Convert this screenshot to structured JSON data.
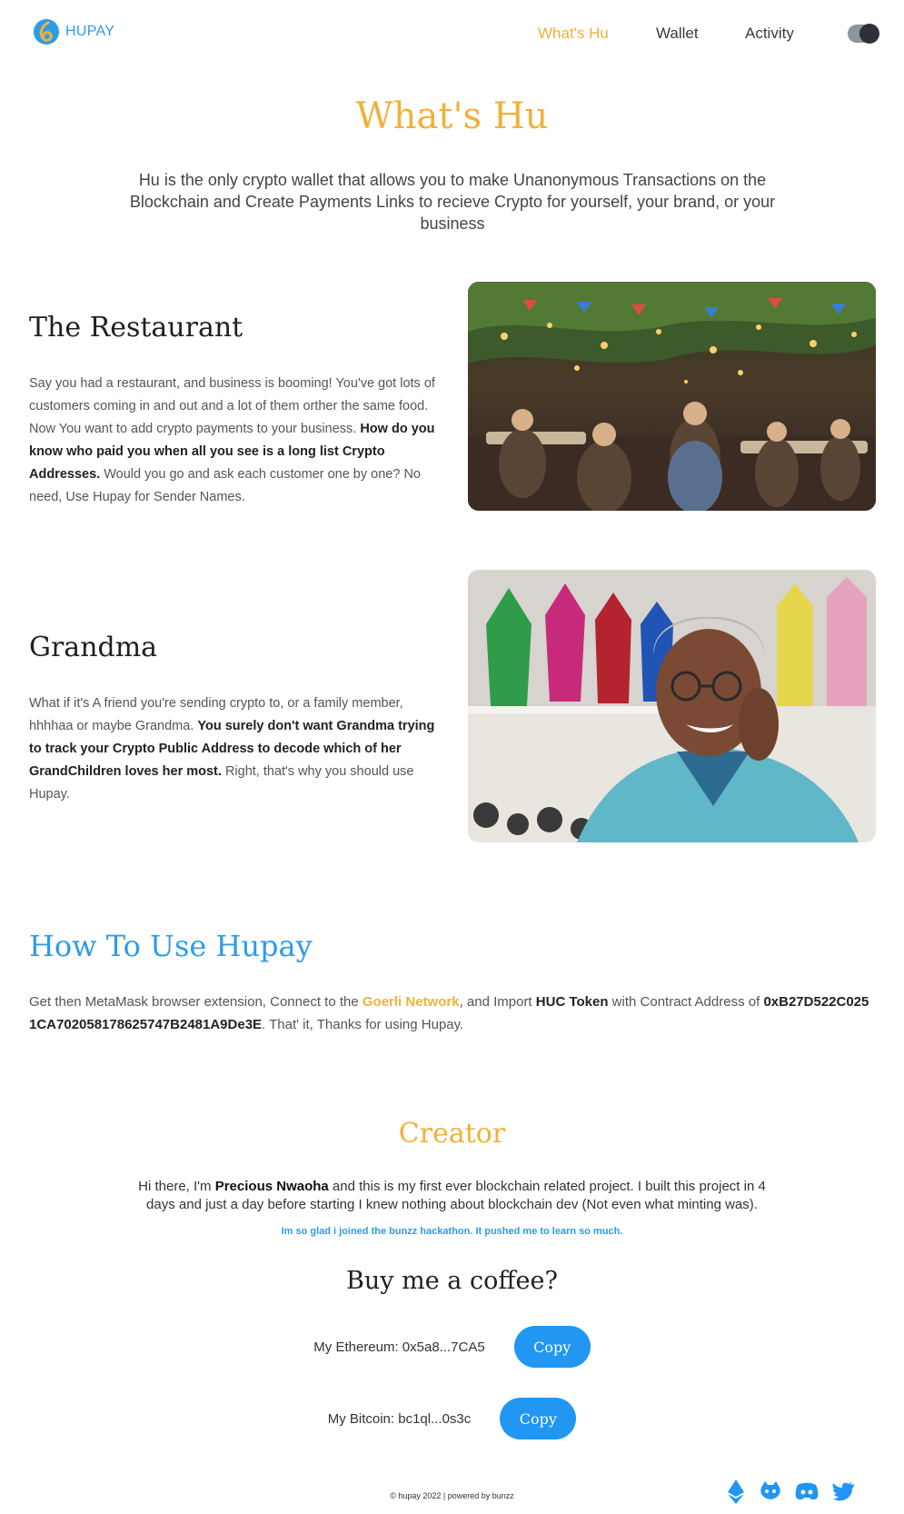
{
  "brand": {
    "name": "HUPAY"
  },
  "nav": {
    "items": [
      {
        "label": "What's Hu",
        "active": true
      },
      {
        "label": "Wallet"
      },
      {
        "label": "Activity"
      }
    ],
    "theme_toggle_icon": "theme-toggle"
  },
  "hero": {
    "title": "What's Hu",
    "description": "Hu is the only crypto wallet that allows you to make Unanonymous Transactions on the Blockchain and Create Payments Links to recieve Crypto for yourself, your brand, or your business"
  },
  "features": [
    {
      "title": "The Restaurant",
      "text_1": "Say you had a restaurant, and business is booming! You've got lots of customers coming in and out and a lot of them orther the same food. Now You want to add crypto payments to your business. ",
      "bold": "How do you know who paid you when all you see is a long list Crypto Addresses.",
      "text_2": " Would you go and ask each customer one by one? No need, Use Hupay for Sender Names.",
      "image": "restaurant-photo"
    },
    {
      "title": "Grandma",
      "text_1": "What if it's A friend you're sending crypto to, or a family member, hhhhaa or maybe Grandma. ",
      "bold": "You surely don't want Grandma trying to track your Crypto Public Address to decode which of her GrandChildren loves her most.",
      "text_2": " Right, that's why you should use Hupay.",
      "image": "grandma-photo"
    }
  ],
  "howto": {
    "title": "How To Use Hupay",
    "t1": "Get then MetaMask browser extension, Connect to the ",
    "network": "Goerli Network",
    "t2": ", and Import ",
    "token": "HUC Token",
    "t3": " with Contract Address of ",
    "address": "0xB27D522C0251CA702058178625747B2481A9De3E",
    "t4": ". That' it, Thanks for using Hupay."
  },
  "creator": {
    "title": "Creator",
    "t1": "Hi there, I'm ",
    "name": "Precious Nwaoha",
    "t2": " and this is my first ever blockchain related project. I built this project in 4 days and just a day before starting I knew nothing about blockchain dev (Not even what minting was).",
    "note": "Im so glad i joined the bunzz hackathon. It pushed me to learn so much."
  },
  "coffee": {
    "title": "Buy me a coffee?",
    "wallets": [
      {
        "label": "My Ethereum: 0x5a8...7CA5",
        "button": "Copy"
      },
      {
        "label": "My Bitcoin: bc1ql...0s3c",
        "button": "Copy"
      }
    ]
  },
  "footer": {
    "text": "© hupay 2022 | powered by bunzz",
    "socials": [
      "ethereum-icon",
      "github-icon",
      "discord-icon",
      "twitter-icon"
    ]
  },
  "colors": {
    "accent": "#f0b13a",
    "blue": "#2e9be8",
    "button": "#2196f3"
  }
}
